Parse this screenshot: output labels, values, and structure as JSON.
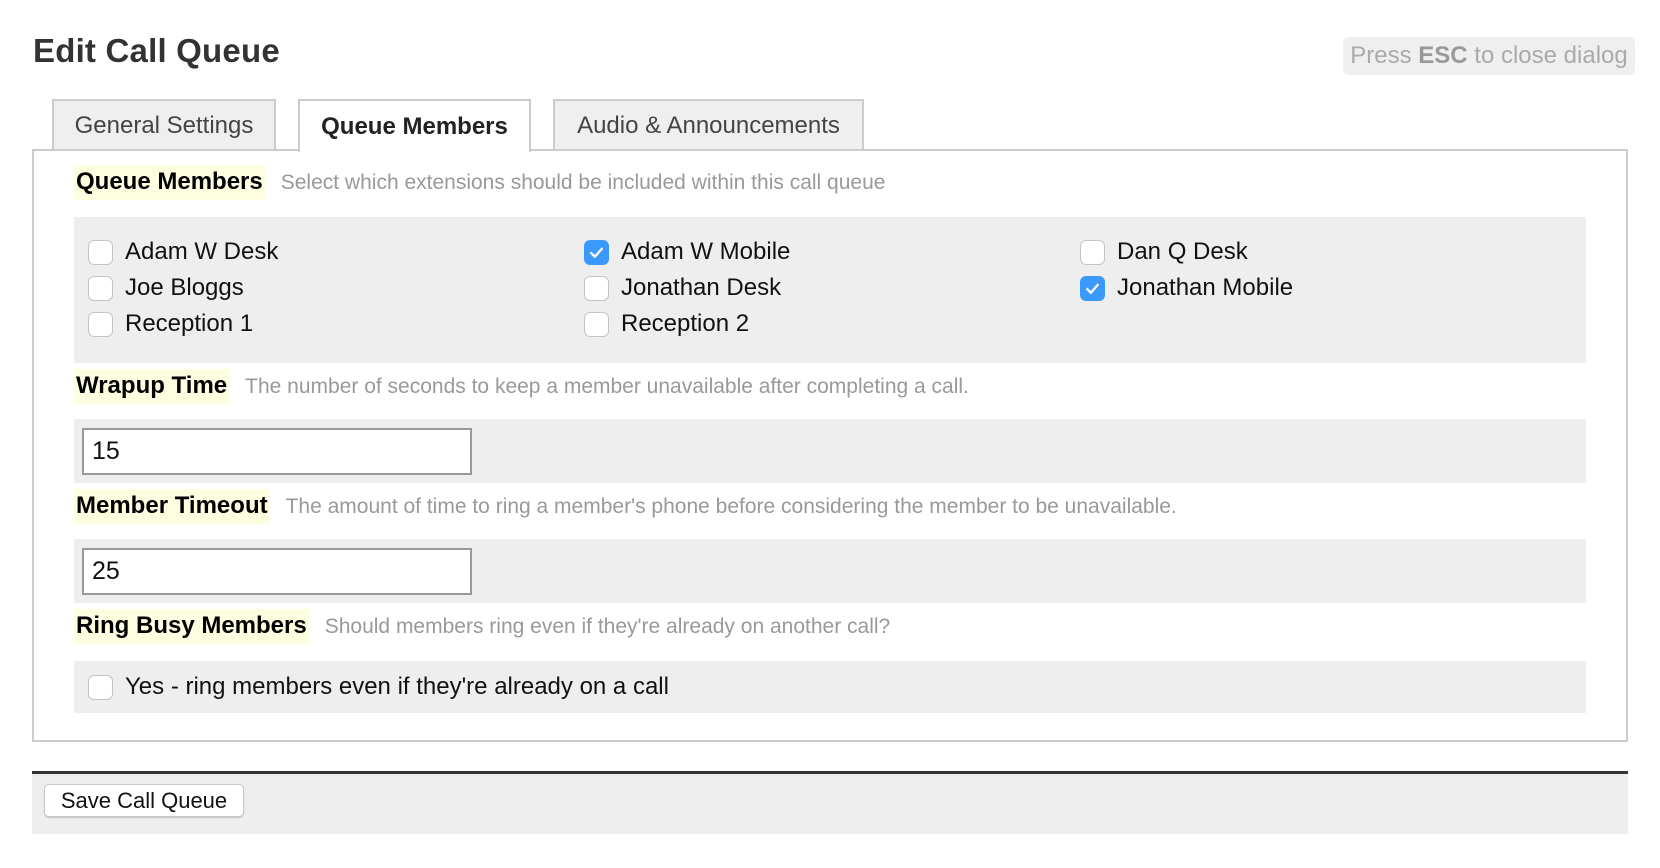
{
  "dialog": {
    "title": "Edit Call Queue",
    "esc_hint": {
      "prefix": "Press ",
      "key": "ESC",
      "suffix": " to close dialog"
    }
  },
  "tabs": [
    {
      "label": "General Settings",
      "active": false
    },
    {
      "label": "Queue Members",
      "active": true
    },
    {
      "label": "Audio & Announcements",
      "active": false
    }
  ],
  "queue_members": {
    "label": "Queue Members",
    "description": "Select which extensions should be included within this call queue",
    "members": [
      {
        "name": "Adam W Desk",
        "checked": false
      },
      {
        "name": "Adam W Mobile",
        "checked": true
      },
      {
        "name": "Dan Q Desk",
        "checked": false
      },
      {
        "name": "Joe Bloggs",
        "checked": false
      },
      {
        "name": "Jonathan Desk",
        "checked": false
      },
      {
        "name": "Jonathan Mobile",
        "checked": true
      },
      {
        "name": "Reception 1",
        "checked": false
      },
      {
        "name": "Reception 2",
        "checked": false
      }
    ]
  },
  "wrapup_time": {
    "label": "Wrapup Time",
    "description": "The number of seconds to keep a member unavailable after completing a call.",
    "value": "15"
  },
  "member_timeout": {
    "label": "Member Timeout",
    "description": "The amount of time to ring a member's phone before considering the member to be unavailable.",
    "value": "25"
  },
  "ring_busy": {
    "label": "Ring Busy Members",
    "description": "Should members ring even if they're already on another call?",
    "option_label": "Yes - ring members even if they're already on a call",
    "checked": false
  },
  "footer": {
    "save_label": "Save Call Queue"
  },
  "colors": {
    "checkbox_checked": "#3b99fc",
    "label_highlight": "#fdfde0",
    "group_bg": "#eeeeee"
  }
}
